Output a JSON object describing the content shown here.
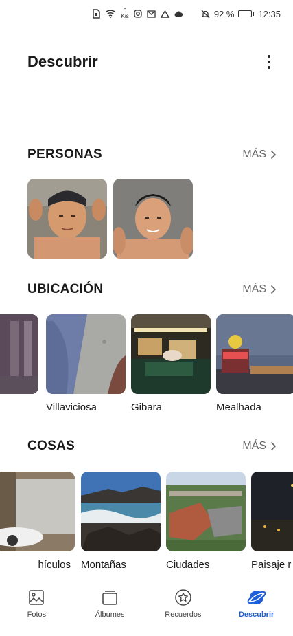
{
  "status_bar": {
    "speed_value": "0",
    "speed_unit": "K/s",
    "battery": "92 %",
    "battery_level": 0.92,
    "time": "12:35"
  },
  "header": {
    "title": "Descubrir"
  },
  "sections": {
    "people": {
      "title": "PERSONAS",
      "more_label": "MÁS"
    },
    "location": {
      "title": "UBICACIÓN",
      "more_label": "MÁS",
      "items": [
        "",
        "Villaviciosa",
        "Gibara",
        "Mealhada"
      ]
    },
    "things": {
      "title": "COSAS",
      "more_label": "MÁS",
      "items": [
        "hículos",
        "Montañas",
        "Ciudades",
        "Paisaje r"
      ]
    }
  },
  "bottom_nav": {
    "items": [
      {
        "label": "Fotos",
        "icon": "photo-icon"
      },
      {
        "label": "Álbumes",
        "icon": "albums-icon"
      },
      {
        "label": "Recuerdos",
        "icon": "star-icon"
      },
      {
        "label": "Descubrir",
        "icon": "planet-icon",
        "active": true
      }
    ]
  },
  "colors": {
    "accent": "#1f5fd9",
    "text": "#1a1a1a",
    "muted": "#666666"
  }
}
